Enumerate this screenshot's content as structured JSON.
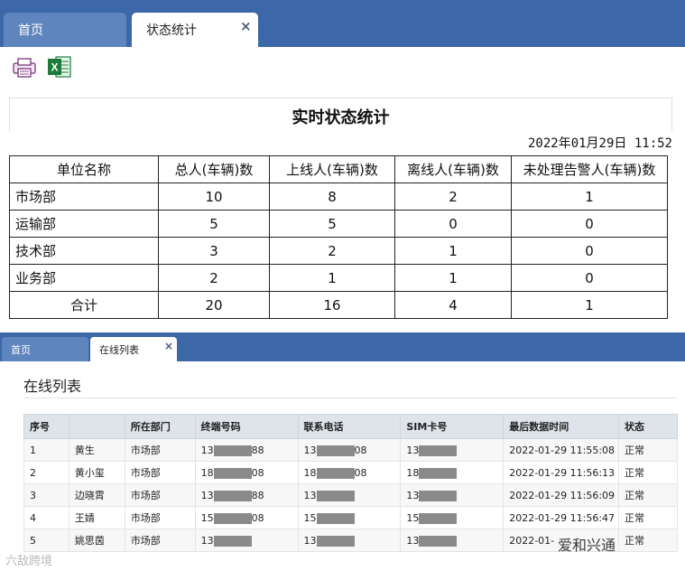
{
  "top_tabs": {
    "home": "首页",
    "active": "状态统计",
    "close": "×"
  },
  "toolbar": {
    "print_icon": "print-icon",
    "excel_icon": "excel-icon",
    "excel_letter": "X"
  },
  "report": {
    "title": "实时状态统计",
    "datetime": "2022年01月29日 11:52",
    "headers": [
      "单位名称",
      "总人(车辆)数",
      "上线人(车辆)数",
      "离线人(车辆)数",
      "未处理告警人(车辆)数"
    ],
    "rows": [
      [
        "市场部",
        "10",
        "8",
        "2",
        "1"
      ],
      [
        "运输部",
        "5",
        "5",
        "0",
        "0"
      ],
      [
        "技术部",
        "3",
        "2",
        "1",
        "0"
      ],
      [
        "业务部",
        "2",
        "1",
        "1",
        "0"
      ],
      [
        "合计",
        "20",
        "16",
        "4",
        "1"
      ]
    ]
  },
  "list_tabs": {
    "home": "首页",
    "active": "在线列表",
    "close": "×"
  },
  "online_list": {
    "title": "在线列表",
    "headers": [
      "序号",
      "",
      "所在部门",
      "终端号码",
      "联系电话",
      "SIM卡号",
      "最后数据时间",
      "状态"
    ],
    "rows": [
      [
        "1",
        "黄生",
        "市场部",
        "13",
        "88",
        "13",
        "08",
        "13",
        "",
        "2022-01-29 11:55:08",
        "正常"
      ],
      [
        "2",
        "黄小玺",
        "市场部",
        "18",
        "08",
        "18",
        "08",
        "18",
        "",
        "2022-01-29 11:56:13",
        "正常"
      ],
      [
        "3",
        "边晓霄",
        "市场部",
        "13",
        "88",
        "13",
        "",
        "13",
        "",
        "2022-01-29 11:56:09",
        "正常"
      ],
      [
        "4",
        "王婧",
        "市场部",
        "15",
        "08",
        "15",
        "",
        "15",
        "",
        "2022-01-29 11:56:47",
        "正常"
      ],
      [
        "5",
        "姚思茵",
        "市场部",
        "13",
        "",
        "13",
        "",
        "13",
        "",
        "2022-01-",
        "正常"
      ]
    ]
  },
  "watermarks": {
    "left": "六敌跨境",
    "right": "爱和兴通"
  }
}
